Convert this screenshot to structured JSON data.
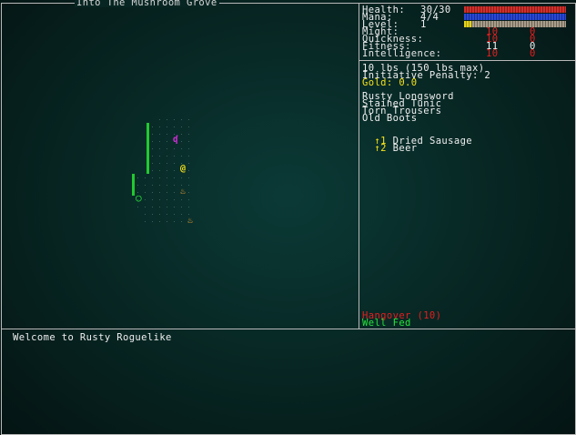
{
  "map": {
    "title": "Into The Mushroom Grove",
    "player_glyph": "@",
    "monster_glyph": "ʠ",
    "item_glyph": "♨",
    "ring_glyph": "○"
  },
  "stats": {
    "health_label": "Health:",
    "health_value": "30/30",
    "mana_label": "Mana:",
    "mana_value": "4/4",
    "level_label": "Level:",
    "level_value": "1",
    "health_fraction": 1.0,
    "mana_fraction": 1.0,
    "xp_fraction": 0.07,
    "attributes": [
      {
        "name": "Might:",
        "value": "10",
        "bonus": "0",
        "color": "#e61e1e"
      },
      {
        "name": "Quickness:",
        "value": "10",
        "bonus": "0",
        "color": "#e61e1e"
      },
      {
        "name": "Fitness:",
        "value": "11",
        "bonus": "0",
        "color": "#f0f0f0"
      },
      {
        "name": "Intelligence:",
        "value": "10",
        "bonus": "0",
        "color": "#e61e1e"
      }
    ]
  },
  "inventory": {
    "weight": "10 lbs (150 lbs max)",
    "initiative": "Initiative Penalty: 2",
    "gold": "Gold: 0.0",
    "equipped": [
      "Rusty Longsword",
      "Stained Tunic",
      "Torn Trousers",
      "Old Boots"
    ],
    "consumables": [
      {
        "key": "↑1",
        "name": "Dried Sausage"
      },
      {
        "key": "↑2",
        "name": "Beer"
      }
    ]
  },
  "status_effects": [
    {
      "text": "Hangover (10)",
      "color": "#e61e1e"
    },
    {
      "text": "Well Fed",
      "color": "#27e23a"
    }
  ],
  "log": {
    "messages": [
      "Welcome to Rusty Roguelike"
    ]
  }
}
